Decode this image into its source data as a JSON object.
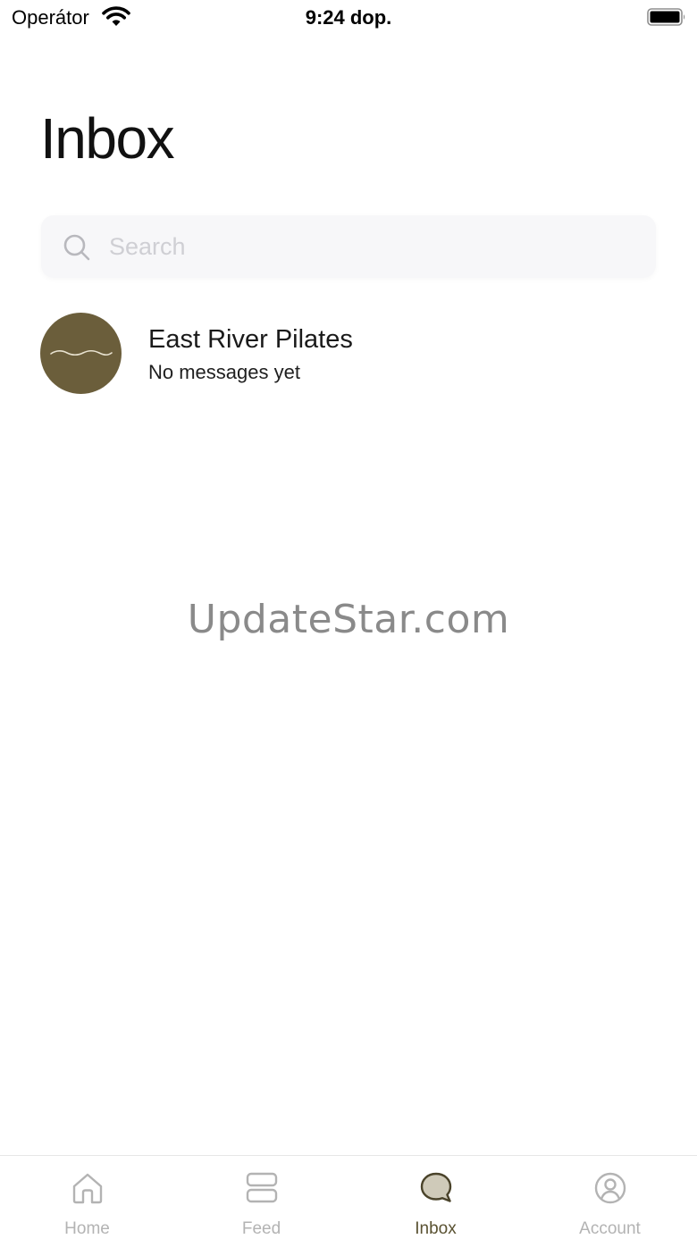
{
  "status_bar": {
    "carrier": "Operátor",
    "time": "9:24 dop."
  },
  "page": {
    "title": "Inbox"
  },
  "search": {
    "placeholder": "Search",
    "value": ""
  },
  "conversations": [
    {
      "name": "East River Pilates",
      "preview": "No messages yet",
      "avatar_color": "#6b5e3b"
    }
  ],
  "watermark": "UpdateStar.com",
  "tab_bar": {
    "tabs": [
      {
        "label": "Home",
        "icon": "home-icon",
        "active": false
      },
      {
        "label": "Feed",
        "icon": "feed-icon",
        "active": false
      },
      {
        "label": "Inbox",
        "icon": "chat-bubble-icon",
        "active": true
      },
      {
        "label": "Account",
        "icon": "account-icon",
        "active": false
      }
    ]
  },
  "colors": {
    "accent": "#5a5232",
    "inactive_tab": "#b3b3b3",
    "search_background": "#f7f7f9"
  }
}
